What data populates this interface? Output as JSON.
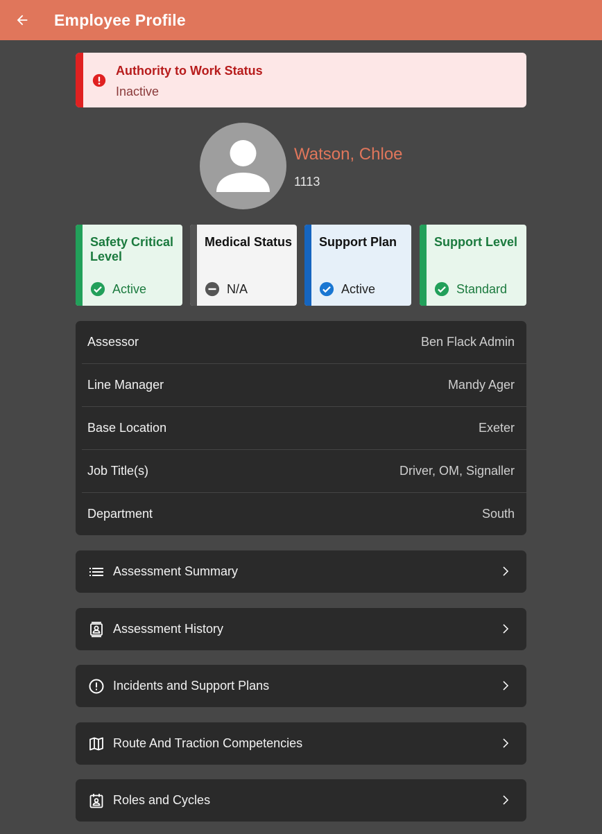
{
  "appbar": {
    "title": "Employee Profile"
  },
  "alert": {
    "title": "Authority to Work Status",
    "value": "Inactive"
  },
  "employee": {
    "name": "Watson, Chloe",
    "id": "1113"
  },
  "status_cards": [
    {
      "title": "Safety Critical Level",
      "status": "Active",
      "icon": "check-circle-icon"
    },
    {
      "title": "Medical Status",
      "status": "N/A",
      "icon": "minus-circle-icon"
    },
    {
      "title": "Support Plan",
      "status": "Active",
      "icon": "check-circle-icon"
    },
    {
      "title": "Support Level",
      "status": "Standard",
      "icon": "check-circle-icon"
    }
  ],
  "details": [
    {
      "label": "Assessor",
      "value": "Ben Flack Admin"
    },
    {
      "label": "Line Manager",
      "value": "Mandy Ager"
    },
    {
      "label": "Base Location",
      "value": "Exeter"
    },
    {
      "label": "Job Title(s)",
      "value": "Driver, OM, Signaller"
    },
    {
      "label": "Department",
      "value": "South"
    }
  ],
  "nav": [
    {
      "label": "Assessment Summary",
      "icon": "list-icon"
    },
    {
      "label": "Assessment History",
      "icon": "contact-card-icon"
    },
    {
      "label": "Incidents and Support Plans",
      "icon": "alert-circle-icon"
    },
    {
      "label": "Route And Traction Competencies",
      "icon": "map-icon"
    },
    {
      "label": "Roles and Cycles",
      "icon": "calendar-user-icon"
    }
  ],
  "colors": {
    "appbar": "#e0765b",
    "background": "#474747",
    "alert_accent": "#e02121",
    "green_accent": "#22a05a",
    "grey_accent": "#555555",
    "blue_accent": "#1565c0"
  }
}
